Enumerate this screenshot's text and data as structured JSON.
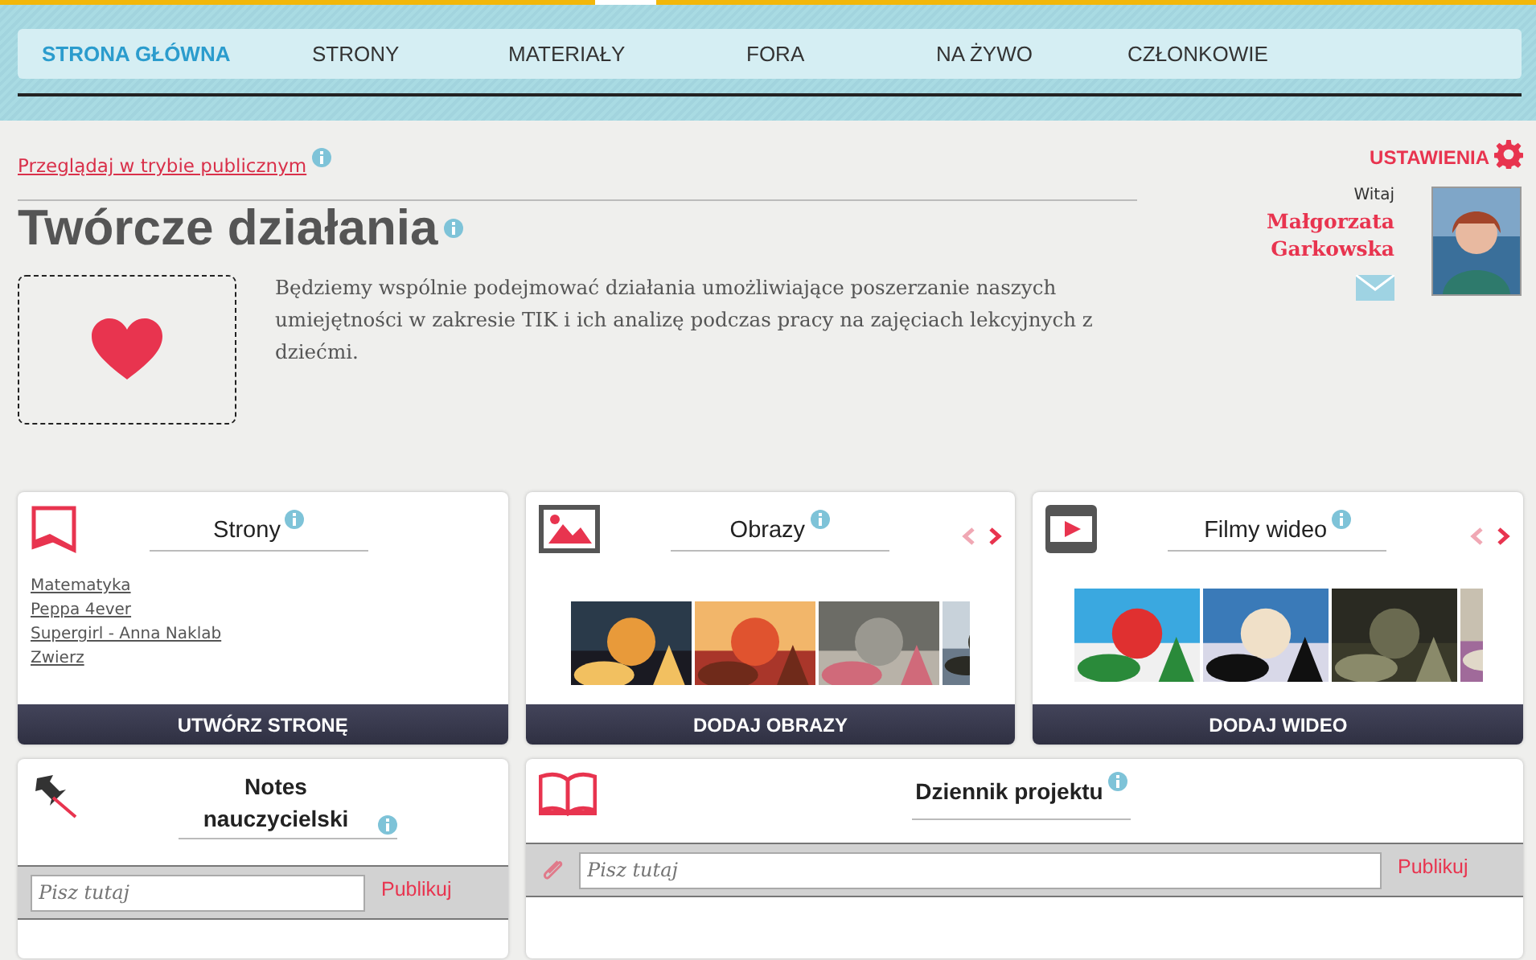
{
  "nav": [
    {
      "label": "STRONA GŁÓWNA",
      "selected": true
    },
    {
      "label": "STRONY",
      "selected": false
    },
    {
      "label": "MATERIAŁY",
      "selected": false
    },
    {
      "label": "FORA",
      "selected": false
    },
    {
      "label": "NA ŻYWO",
      "selected": false
    },
    {
      "label": "CZŁONKOWIE",
      "selected": false
    }
  ],
  "public_link": "Przeglądaj w trybie publicznym",
  "settings": "USTAWIENIA",
  "title": "Twórcze działania",
  "description": "Będziemy wspólnie podejmować działania umożliwiające poszerzanie naszych umiejętności w zakresie TIK i ich analizę podczas pracy na zajęciach lekcyjnych z dziećmi.",
  "user": {
    "greeting": "Witaj",
    "name": "Małgorzata Garkowska"
  },
  "cards": [
    {
      "kind": "pages",
      "title": "Strony",
      "links": [
        "Matematyka",
        "Peppa 4ever",
        "Supergirl - Anna Naklab",
        "Zwierz"
      ],
      "action": "UTWÓRZ STRONĘ"
    },
    {
      "kind": "images",
      "title": "Obrazy",
      "arrows": [
        {
          "kind": "prev",
          "disabled": true
        },
        {
          "kind": "next",
          "disabled": false
        }
      ],
      "thumbs": [
        {
          "kind": "picture"
        },
        {
          "kind": "picture"
        },
        {
          "kind": "picture"
        },
        {
          "kind": "picture"
        }
      ],
      "action": "DODAJ OBRAZY"
    },
    {
      "kind": "videos",
      "title": "Filmy wideo",
      "arrows": [
        {
          "kind": "prev",
          "disabled": true
        },
        {
          "kind": "next",
          "disabled": false
        }
      ],
      "thumbs": [
        {
          "kind": "picture"
        },
        {
          "kind": "picture"
        },
        {
          "kind": "picture"
        },
        {
          "kind": "picture"
        }
      ],
      "action": "DODAJ WIDEO"
    }
  ],
  "notes": {
    "title": "Notes nauczycielski",
    "placeholder": "Pisz tutaj",
    "publish": "Publikuj"
  },
  "journal": {
    "title": "Dziennik projektu",
    "placeholder": "Pisz tutaj",
    "publish": "Publikuj"
  }
}
